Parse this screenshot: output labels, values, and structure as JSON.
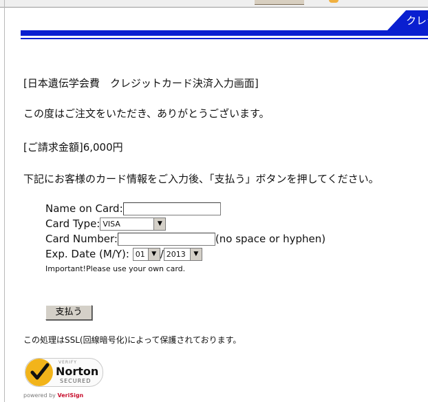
{
  "header": {
    "tab_label": "クレジ"
  },
  "messages": {
    "title": "[日本遺伝学会費　クレジットカード決済入力画面]",
    "thanks": "この度はご注文をいただき、ありがとうございます。",
    "amount": "[ご請求金額]6,000円",
    "instruction": "下記にお客様のカード情報をご入力後、「支払う」ボタンを押してください。"
  },
  "form": {
    "name_label": "Name on Card:",
    "name_value": "",
    "card_type_label": "Card Type:",
    "card_type_value": "VISA",
    "card_number_label": "Card Number:",
    "card_number_value": "",
    "card_number_hint": "(no space or hyphen)",
    "exp_label": "Exp. Date (M/Y):",
    "exp_month": "01",
    "exp_separator": "/",
    "exp_year": "2013",
    "note": "Important!Please use your own card."
  },
  "pay_button_label": "支払う",
  "ssl_note": "この処理はSSL(回線暗号化)によって保護されております。",
  "norton": {
    "verify": "VERIFY",
    "brand": "Norton",
    "secured": "SECURED",
    "powered_by": "powered by",
    "provider": "VeriSign"
  },
  "colors": {
    "accent_blue": "#0a1fd0",
    "norton_yellow": "#f2b41a"
  }
}
